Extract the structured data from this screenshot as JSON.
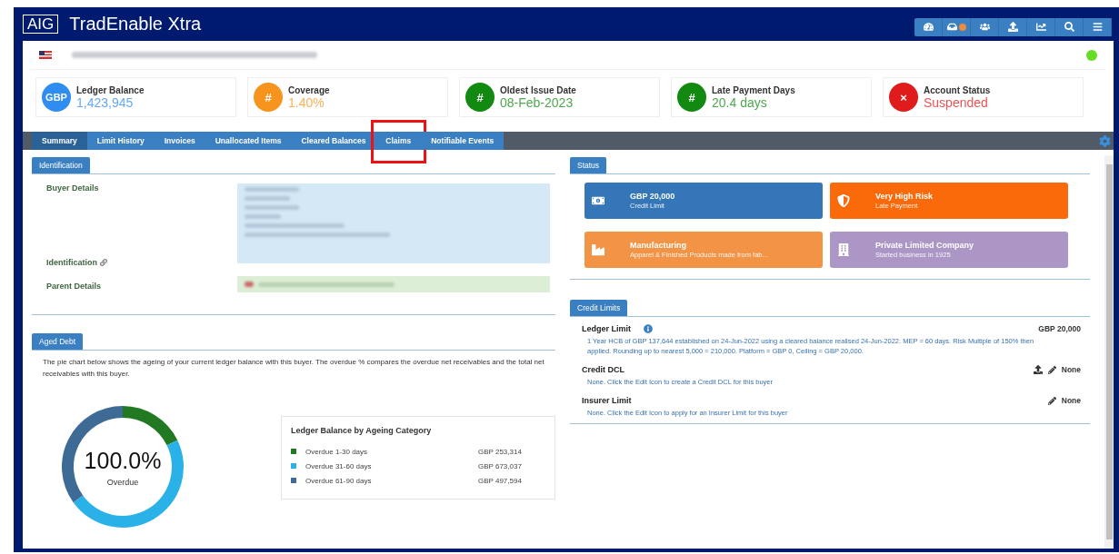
{
  "app": {
    "logo": "AIG",
    "title": "TradEnable Xtra"
  },
  "toolbar": {
    "notification": true
  },
  "kpis": [
    {
      "badge": "GBP",
      "color": "#2f8cf0",
      "label": "Ledger Balance",
      "value": "1,423,945"
    },
    {
      "badge": "#",
      "color": "#f7941d",
      "label": "Coverage",
      "value": "1.40%"
    },
    {
      "badge": "#",
      "color": "#128a12",
      "label": "Oldest Issue Date",
      "value": "08-Feb-2023"
    },
    {
      "badge": "#",
      "color": "#128a12",
      "label": "Late Payment Days",
      "value": "20.4 days"
    },
    {
      "badge": "×",
      "color": "#e01b1b",
      "label": "Account Status",
      "value": "Suspended"
    }
  ],
  "tabs": [
    {
      "label": "Summary",
      "selected": true,
      "highlighted": false
    },
    {
      "label": "Limit History",
      "selected": false,
      "highlighted": false
    },
    {
      "label": "Invoices",
      "selected": false,
      "highlighted": false
    },
    {
      "label": "Unallocated Items",
      "selected": false,
      "highlighted": false
    },
    {
      "label": "Cleared Balances",
      "selected": false,
      "highlighted": false
    },
    {
      "label": "Claims",
      "selected": false,
      "highlighted": true
    },
    {
      "label": "Notifiable Events",
      "selected": false,
      "highlighted": false
    }
  ],
  "identification": {
    "heading": "Identification",
    "rows": [
      {
        "label": "Buyer Details",
        "link_icon": false
      },
      {
        "label": "Identification",
        "link_icon": true
      },
      {
        "label": "Parent Details",
        "link_icon": false
      }
    ]
  },
  "aged_debt": {
    "heading": "Aged Debt",
    "description": "The pie chart below shows the ageing of your current ledger balance with this buyer. The overdue % compares the overdue net receivables and the total net receivables with this buyer.",
    "center_value": "100.0%",
    "center_label": "Overdue",
    "chart_data": {
      "type": "donut",
      "categories": [
        "Overdue 1-30 days",
        "Overdue 31-60 days",
        "Overdue 61-90 days"
      ],
      "values": [
        17.79,
        47.27,
        34.94
      ]
    },
    "legend": {
      "title": "Ledger Balance by Ageing Category",
      "items": [
        {
          "amount": "GBP 253,314",
          "color": "#217a21"
        },
        {
          "amount": "GBP 673,037",
          "color": "#2ab1e8"
        },
        {
          "amount": "GBP 497,594",
          "color": "#3e6a96"
        }
      ]
    }
  },
  "status": {
    "heading": "Status",
    "tiles": [
      {
        "title": "GBP 20,000",
        "subtitle": "Credit Limit",
        "color": "#3476b8"
      },
      {
        "title": "Very High Risk",
        "subtitle": "Late Payment",
        "color": "#fb6a0a"
      },
      {
        "title": "Manufacturing",
        "subtitle": "Apparel & Finished Products made from fab...",
        "color": "#f29345"
      },
      {
        "title": "Private Limited Company",
        "subtitle": "Started business in 1925",
        "color": "#ac96c6"
      }
    ]
  },
  "credit_limits": {
    "heading": "Credit Limits",
    "items": [
      {
        "title": "Ledger Limit",
        "info": true,
        "upload": false,
        "edit": false,
        "value": "GBP 20,000",
        "note": "1 Year HCB of GBP 137,644 established on 24-Jun-2022 using a cleared balance realised 24-Jun-2022. MEP = 60 days. Risk Multiple of 150% then applied. Rounding up to nearest 5,000 = 210,000. Platform = GBP 0, Ceiling = GBP 20,000."
      },
      {
        "title": "Credit DCL",
        "info": false,
        "upload": true,
        "edit": true,
        "value": "None",
        "note": "None. Click the Edit Icon to create a Credit DCL for this buyer"
      },
      {
        "title": "Insurer Limit",
        "info": false,
        "upload": false,
        "edit": true,
        "value": "None",
        "note": "None. Click the Edit Icon to apply for an Insurer Limit for this buyer"
      }
    ]
  }
}
